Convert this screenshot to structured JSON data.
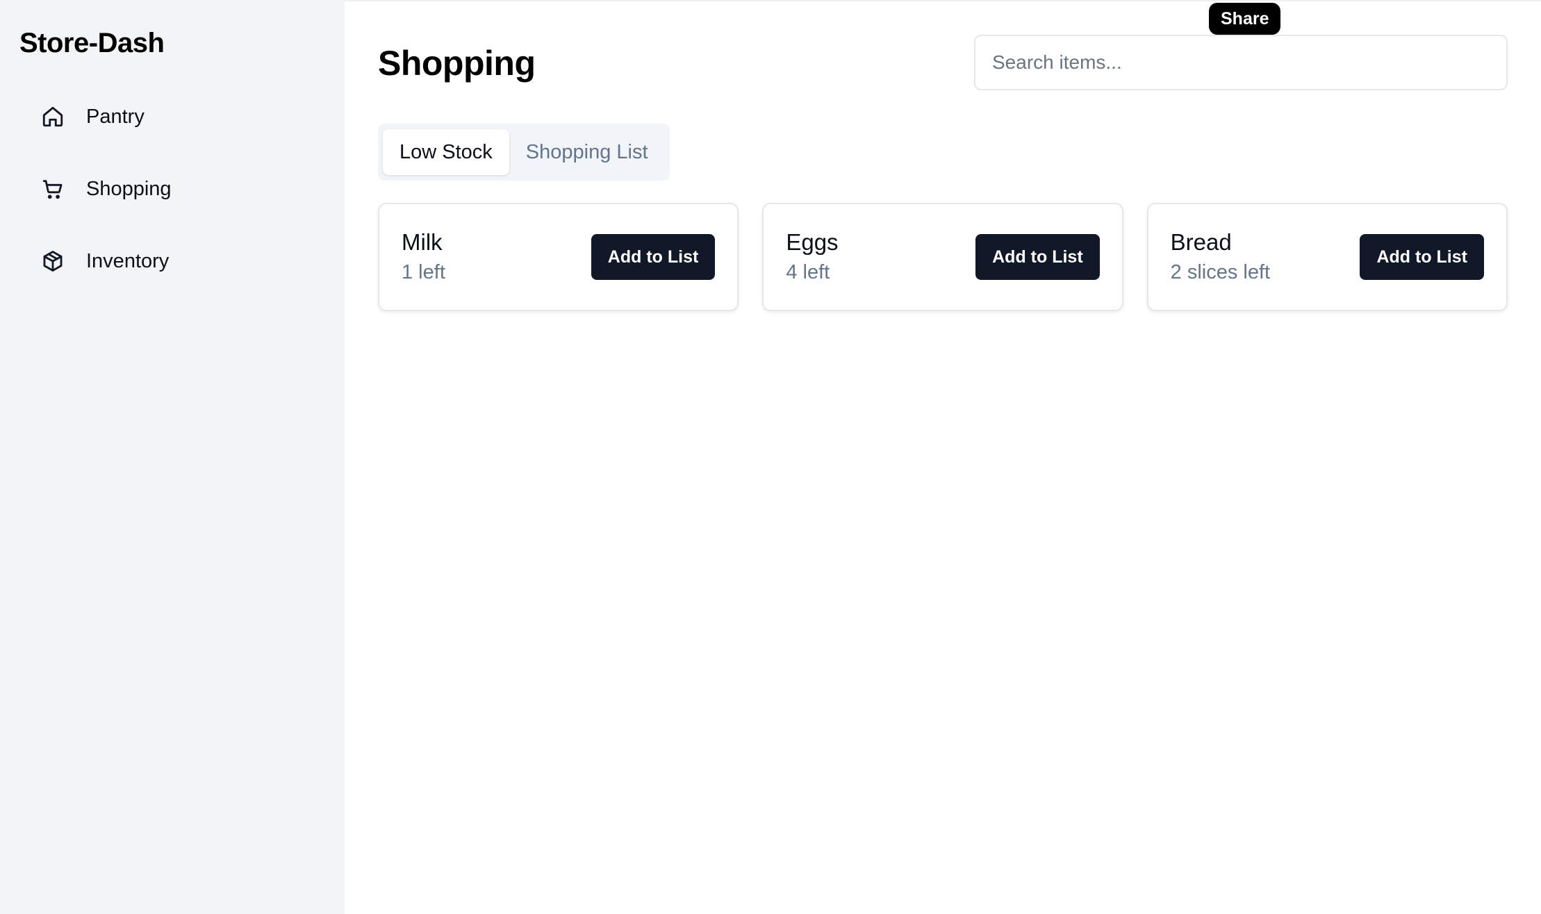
{
  "app": {
    "brand": "Store-Dash"
  },
  "sidebar": {
    "items": [
      {
        "label": "Pantry",
        "icon": "home-icon"
      },
      {
        "label": "Shopping",
        "icon": "cart-icon"
      },
      {
        "label": "Inventory",
        "icon": "box-icon"
      }
    ]
  },
  "main": {
    "title": "Shopping",
    "search": {
      "placeholder": "Search items..."
    },
    "tooltip": "Share",
    "tabs": [
      {
        "label": "Low Stock",
        "active": true
      },
      {
        "label": "Shopping List",
        "active": false
      }
    ],
    "cards": [
      {
        "name": "Milk",
        "quantity": "1 left",
        "button": "Add to List"
      },
      {
        "name": "Eggs",
        "quantity": "4 left",
        "button": "Add to List"
      },
      {
        "name": "Bread",
        "quantity": "2 slices left",
        "button": "Add to List"
      }
    ]
  },
  "colors": {
    "sidebar_bg": "#f3f4f6",
    "button_bg": "#111827",
    "muted_text": "#64748b"
  }
}
